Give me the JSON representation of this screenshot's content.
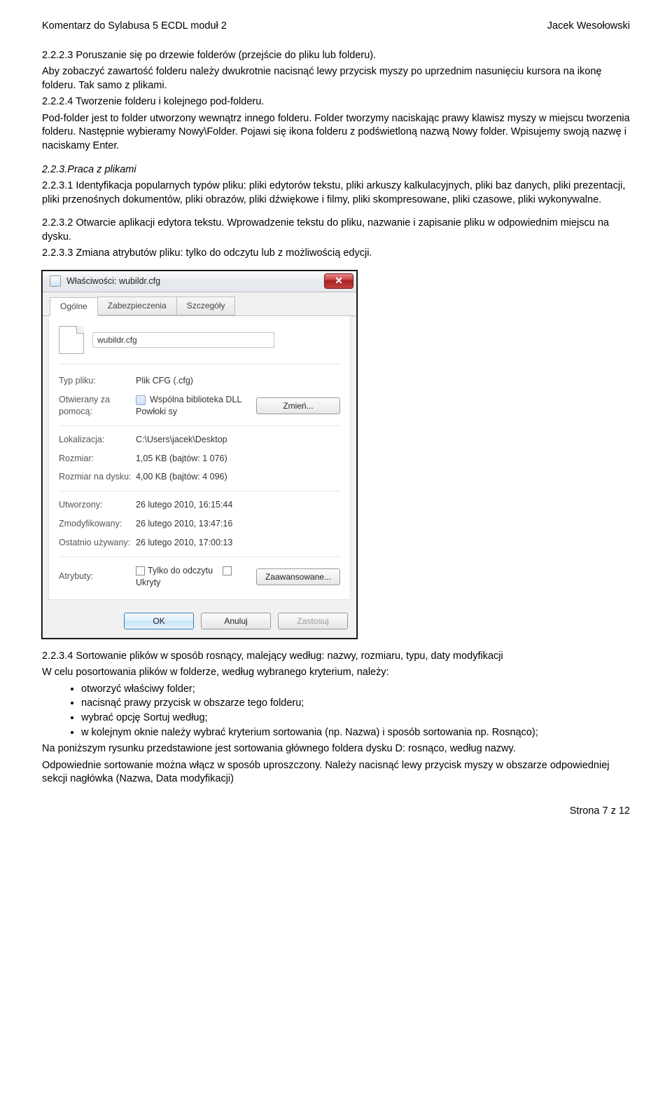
{
  "header": {
    "left": "Komentarz do Sylabusa 5 ECDL moduł 2",
    "right": "Jacek Wesołowski"
  },
  "text": {
    "p1": "2.2.2.3 Poruszanie się po drzewie folderów (przejście do pliku lub folderu).",
    "p2": "Aby zobaczyć zawartość folderu należy dwukrotnie nacisnąć lewy przycisk myszy po uprzednim nasunięciu kursora na ikonę folderu. Tak samo z plikami.",
    "p3": "2.2.2.4 Tworzenie folderu i kolejnego pod-folderu.",
    "p4": "Pod-folder jest to folder utworzony wewnątrz innego folderu. Folder tworzymy naciskając prawy klawisz myszy w miejscu tworzenia folderu. Następnie wybieramy Nowy\\Folder. Pojawi się ikona folderu z podświetloną nazwą Nowy folder. Wpisujemy swoją nazwę i naciskamy Enter.",
    "h1": "2.2.3.Praca z plikami",
    "p5": "2.2.3.1 Identyfikacja popularnych typów pliku: pliki edytorów tekstu, pliki arkuszy kalkulacyjnych, pliki baz danych, pliki prezentacji, pliki przenośnych dokumentów, pliki obrazów, pliki dźwiękowe i filmy, pliki skompresowane, pliki czasowe, pliki wykonywalne.",
    "p6": "2.2.3.2 Otwarcie aplikacji edytora tekstu. Wprowadzenie tekstu do pliku, nazwanie i zapisanie pliku w odpowiednim miejscu na dysku.",
    "p7": "2.2.3.3 Zmiana atrybutów pliku: tylko do odczytu lub z możliwością edycji.",
    "p8": "2.2.3.4 Sortowanie plików w sposób rosnący, malejący według: nazwy, rozmiaru, typu, daty modyfikacji",
    "p9": "W celu posortowania plików w folderze, według wybranego kryterium, należy:",
    "bullets": [
      "otworzyć właściwy folder;",
      "nacisnąć prawy przycisk w obszarze tego folderu;",
      "wybrać opcję Sortuj według;",
      "w kolejnym oknie należy wybrać kryterium sortowania (np. Nazwa) i sposób sortowania np. Rosnąco);"
    ],
    "p10": "Na poniższym rysunku przedstawione jest sortowania głównego foldera dysku D: rosnąco, według nazwy.",
    "p11": "Odpowiednie sortowanie można włącz w sposób uproszczony. Należy nacisnąć lewy przycisk myszy w obszarze odpowiedniej sekcji nagłówka (Nazwa, Data modyfikacji)"
  },
  "dialog": {
    "title": "Właściwości: wubildr.cfg",
    "tabs": [
      "Ogólne",
      "Zabezpieczenia",
      "Szczegóły"
    ],
    "filename": "wubildr.cfg",
    "labels": {
      "type": "Typ pliku:",
      "opens": "Otwierany za pomocą:",
      "location": "Lokalizacja:",
      "size": "Rozmiar:",
      "sizeDisk": "Rozmiar na dysku:",
      "created": "Utworzony:",
      "modified": "Zmodyfikowany:",
      "accessed": "Ostatnio używany:",
      "attrs": "Atrybuty:"
    },
    "values": {
      "type": "Plik CFG (.cfg)",
      "opens": "Wspólna biblioteka DLL Powłoki sy",
      "location": "C:\\Users\\jacek\\Desktop",
      "size": "1,05 KB (bajtów: 1 076)",
      "sizeDisk": "4,00 KB (bajtów: 4 096)",
      "created": "26 lutego 2010, 16:15:44",
      "modified": "26 lutego 2010, 13:47:16",
      "accessed": "26 lutego 2010, 17:00:13"
    },
    "attrs": {
      "readonly": "Tylko do odczytu",
      "hidden": "Ukryty"
    },
    "buttons": {
      "change": "Zmień...",
      "advanced": "Zaawansowane...",
      "ok": "OK",
      "cancel": "Anuluj",
      "apply": "Zastosuj"
    }
  },
  "footer": "Strona 7 z 12"
}
